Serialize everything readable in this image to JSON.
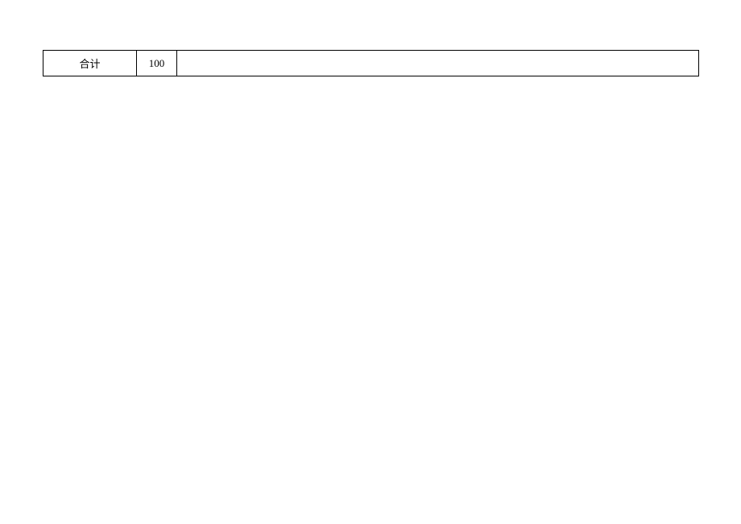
{
  "table": {
    "row": {
      "label": "合计",
      "value": "100",
      "extra": ""
    }
  }
}
